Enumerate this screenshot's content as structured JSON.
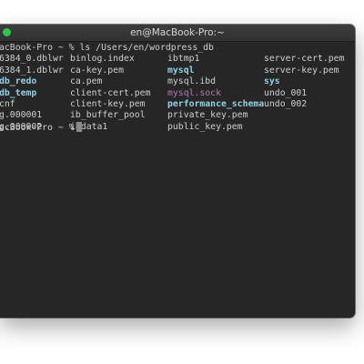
{
  "window": {
    "title": "en@MacBook-Pro:~",
    "traffic_light_colors": {
      "zoom": "#2ac94a"
    }
  },
  "terminal": {
    "command_line": "acBook-Pro ~ % ls /Users/en/wordpress_db",
    "rows": [
      [
        {
          "text": "6384_0.dblwr",
          "style": "file"
        },
        {
          "text": "binlog.index",
          "style": "file"
        },
        {
          "text": "ibtmp1",
          "style": "file"
        },
        {
          "text": "server-cert.pem",
          "style": "file"
        }
      ],
      [
        {
          "text": "6384_1.dblwr",
          "style": "file"
        },
        {
          "text": "ca-key.pem",
          "style": "file"
        },
        {
          "text": "mysql",
          "style": "dir"
        },
        {
          "text": "server-key.pem",
          "style": "file"
        }
      ],
      [
        {
          "text": "db_redo",
          "style": "dir"
        },
        {
          "text": "ca.pem",
          "style": "file"
        },
        {
          "text": "mysql.ibd",
          "style": "file"
        },
        {
          "text": "sys",
          "style": "dir"
        }
      ],
      [
        {
          "text": "db_temp",
          "style": "dir"
        },
        {
          "text": "client-cert.pem",
          "style": "file"
        },
        {
          "text": "mysql.sock",
          "style": "sock"
        },
        {
          "text": "undo_001",
          "style": "file"
        }
      ],
      [
        {
          "text": "cnf",
          "style": "file"
        },
        {
          "text": "client-key.pem",
          "style": "file"
        },
        {
          "text": "performance_schema",
          "style": "dir"
        },
        {
          "text": "undo_002",
          "style": "file"
        }
      ],
      [
        {
          "text": "g.000001",
          "style": "file"
        },
        {
          "text": "ib_buffer_pool",
          "style": "file"
        },
        {
          "text": "private_key.pem",
          "style": "file"
        },
        {
          "text": "",
          "style": "file"
        }
      ],
      [
        {
          "text": "g.000002",
          "style": "file"
        },
        {
          "text": "ibdata1",
          "style": "file"
        },
        {
          "text": "public_key.pem",
          "style": "file"
        },
        {
          "text": "",
          "style": "file"
        }
      ]
    ],
    "prompt_line": "acBook-Pro ~ %",
    "colors": {
      "background": "#262626",
      "text": "#cfcfcf",
      "directory": "#8fd3e3",
      "socket": "#b07aa6",
      "cursor": "#8a8a8a"
    }
  }
}
